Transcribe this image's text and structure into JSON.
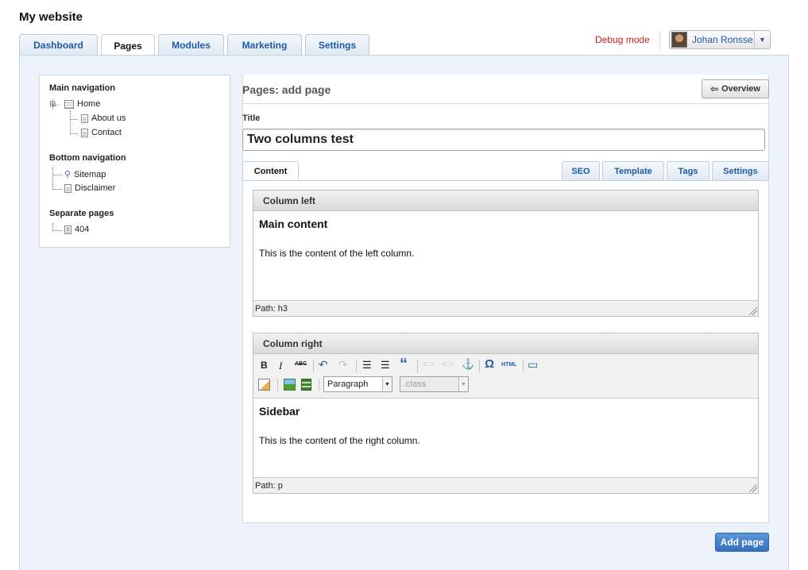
{
  "app": {
    "title": "My website"
  },
  "main_tabs": [
    {
      "label": "Dashboard",
      "active": false
    },
    {
      "label": "Pages",
      "active": true
    },
    {
      "label": "Modules",
      "active": false
    },
    {
      "label": "Marketing",
      "active": false
    },
    {
      "label": "Settings",
      "active": false
    }
  ],
  "header": {
    "debug_label": "Debug mode",
    "user_name": "Johan Ronsse",
    "dropdown_icon": "triangle-down"
  },
  "tree": {
    "main_heading": "Main navigation",
    "main_items": [
      "Home",
      "About us",
      "Contact"
    ],
    "bottom_heading": "Bottom navigation",
    "bottom_items": [
      "Sitemap",
      "Disclaimer"
    ],
    "separate_heading": "Separate pages",
    "separate_items": [
      "404"
    ]
  },
  "page": {
    "heading": "Pages: add page",
    "overview_label": "Overview"
  },
  "form": {
    "title_label": "Title",
    "title_value": "Two columns test"
  },
  "content_tabs": {
    "left": "Content",
    "right": [
      "SEO",
      "Template",
      "Tags",
      "Settings"
    ]
  },
  "editor_left": {
    "header": "Column left",
    "heading": "Main content",
    "text": "This is the content of the left column.",
    "path": "Path: h3"
  },
  "editor_right": {
    "header": "Column right",
    "heading": "Sidebar",
    "text": "This is the content of the right column.",
    "path": "Path: p",
    "format_select": "Paragraph",
    "class_select": ".class",
    "toolbar_buttons": {
      "bold": "B",
      "italic": "I",
      "strike": "ABC",
      "undo": "↶",
      "redo": "↷",
      "ul": "☰",
      "ol": "☰",
      "quote": "“",
      "link": "⊂⊃",
      "unlink": "⊂⊃",
      "anchor": "⚓",
      "omega": "Ω",
      "html": "HTML",
      "fullscreen": "▭"
    }
  },
  "actions": {
    "add_page": "Add page"
  },
  "colors": {
    "accent": "#1f5aa8",
    "debug": "#cc1d1d",
    "panel": "#ebf2f9",
    "primary_button": "#3f7ccb"
  }
}
